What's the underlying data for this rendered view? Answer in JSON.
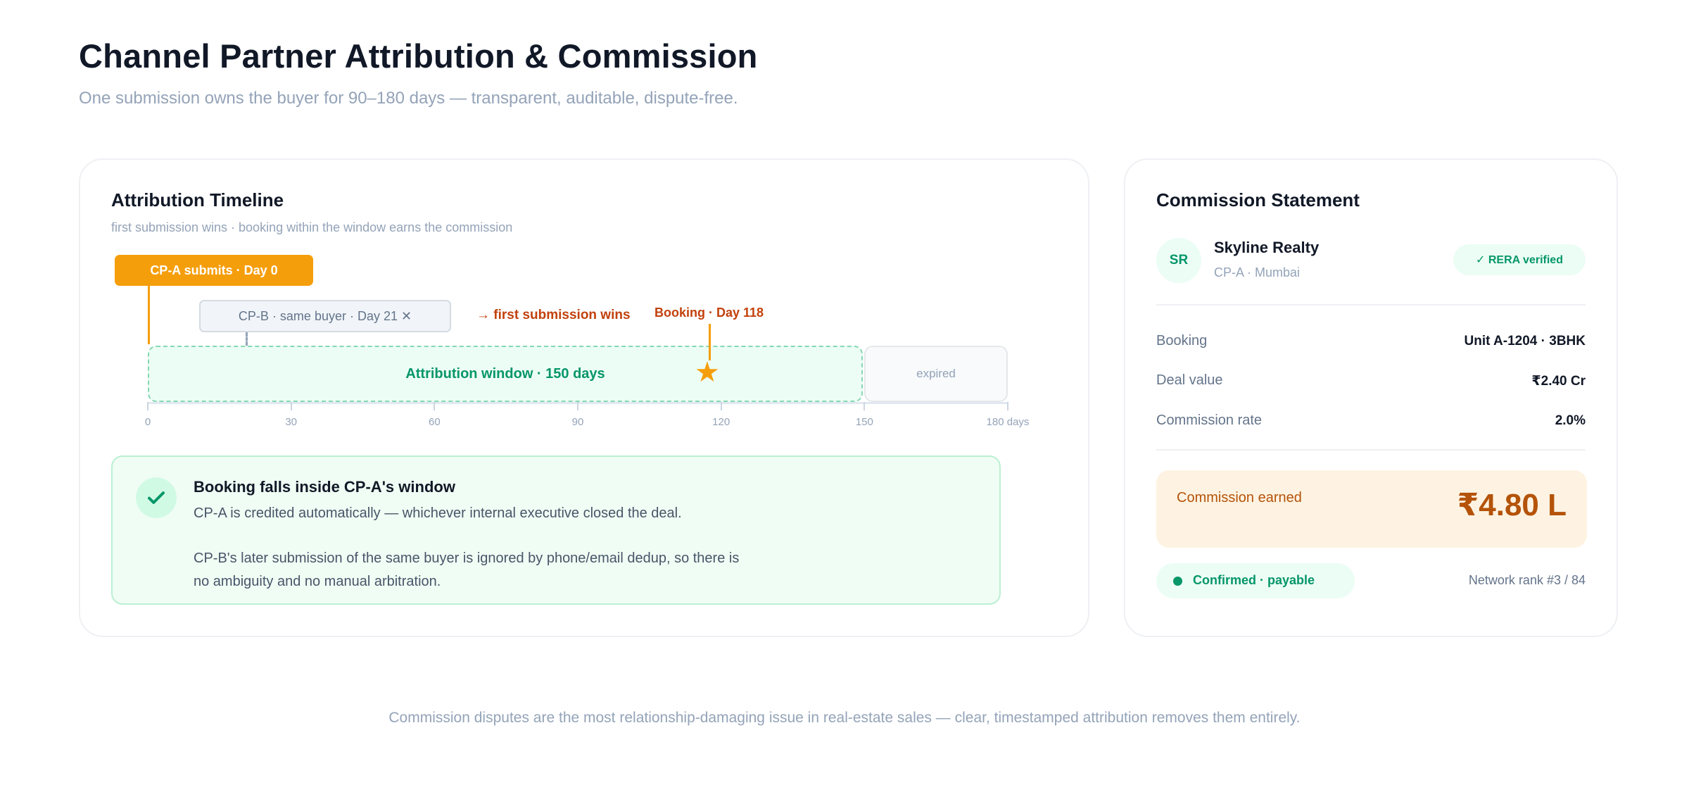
{
  "header": {
    "title": "Channel Partner Attribution & Commission",
    "subtitle": "One submission owns the buyer for 90–180 days — transparent, auditable, dispute-free."
  },
  "timeline": {
    "title": "Attribution Timeline",
    "subtitle": "first submission wins · booking within the window earns the commission",
    "cpa_tag": "CP-A submits · Day 0",
    "cpb_tag": "CP-B · same buyer · Day 21 ✕",
    "wins_text": "→ first submission wins",
    "booking_label": "Booking · Day 118",
    "window_label": "Attribution window · 150 days",
    "expired_label": "expired",
    "axis_ticks": [
      "0",
      "30",
      "60",
      "90",
      "120",
      "150",
      "180 days"
    ],
    "star_icon": "star-icon"
  },
  "result": {
    "title": "Booking falls inside CP-A's window",
    "line1": "CP-A is credited automatically — whichever internal executive closed the deal.",
    "line2": "CP-B's later submission of the same buyer is ignored by phone/email dedup, so there is",
    "line3": "no ambiguity and no manual arbitration.",
    "icon": "check-icon"
  },
  "statement": {
    "title": "Commission Statement",
    "avatar_initials": "SR",
    "company": "Skyline Realty",
    "company_sub": "CP-A · Mumbai",
    "rera_badge": "✓ RERA verified",
    "rows": [
      {
        "label": "Booking",
        "value": "Unit A-1204 · 3BHK"
      },
      {
        "label": "Deal value",
        "value": "₹2.40 Cr"
      },
      {
        "label": "Commission rate",
        "value": "2.0%"
      }
    ],
    "earned_label": "Commission earned",
    "earned_value": "₹4.80 L",
    "status": "Confirmed · payable",
    "rank": "Network rank #3 / 84"
  },
  "footer": "Commission disputes are the most relationship-damaging issue in real-estate sales — clear, timestamped attribution removes them entirely.",
  "colors": {
    "accent_orange": "#f59e0b",
    "accent_green": "#059669",
    "earned_brown": "#b45309"
  }
}
